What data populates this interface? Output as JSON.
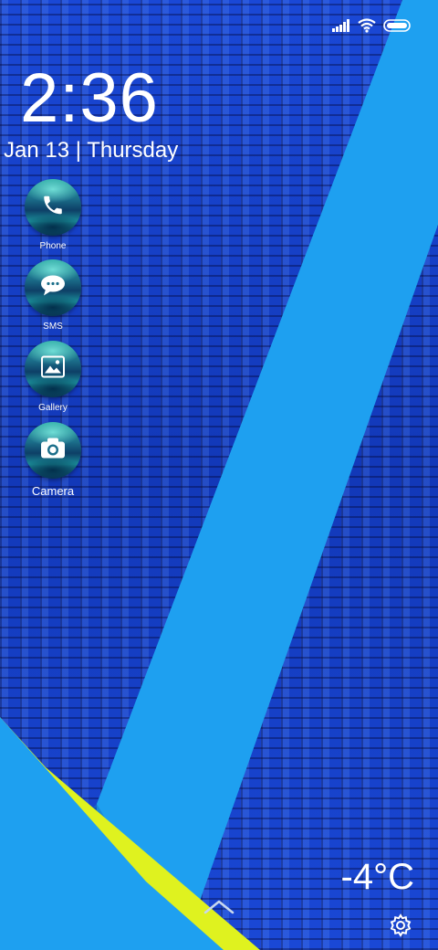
{
  "status_bar": {
    "icons": [
      "signal-icon",
      "wifi-icon",
      "battery-icon"
    ]
  },
  "lockscreen": {
    "time": "2:36",
    "date": "Jan 13 | Thursday"
  },
  "apps": [
    {
      "label": "Phone",
      "icon": "phone-icon"
    },
    {
      "label": "SMS",
      "icon": "message-icon"
    },
    {
      "label": "Gallery",
      "icon": "image-icon"
    },
    {
      "label": "Camera",
      "icon": "camera-icon"
    }
  ],
  "weather": {
    "temperature": "-4°C"
  },
  "colors": {
    "wallpaper_blue": "#1640c8",
    "stripe_light_blue": "#1ea0f0",
    "stripe_yellow": "#dff21f",
    "text": "#ffffff"
  }
}
